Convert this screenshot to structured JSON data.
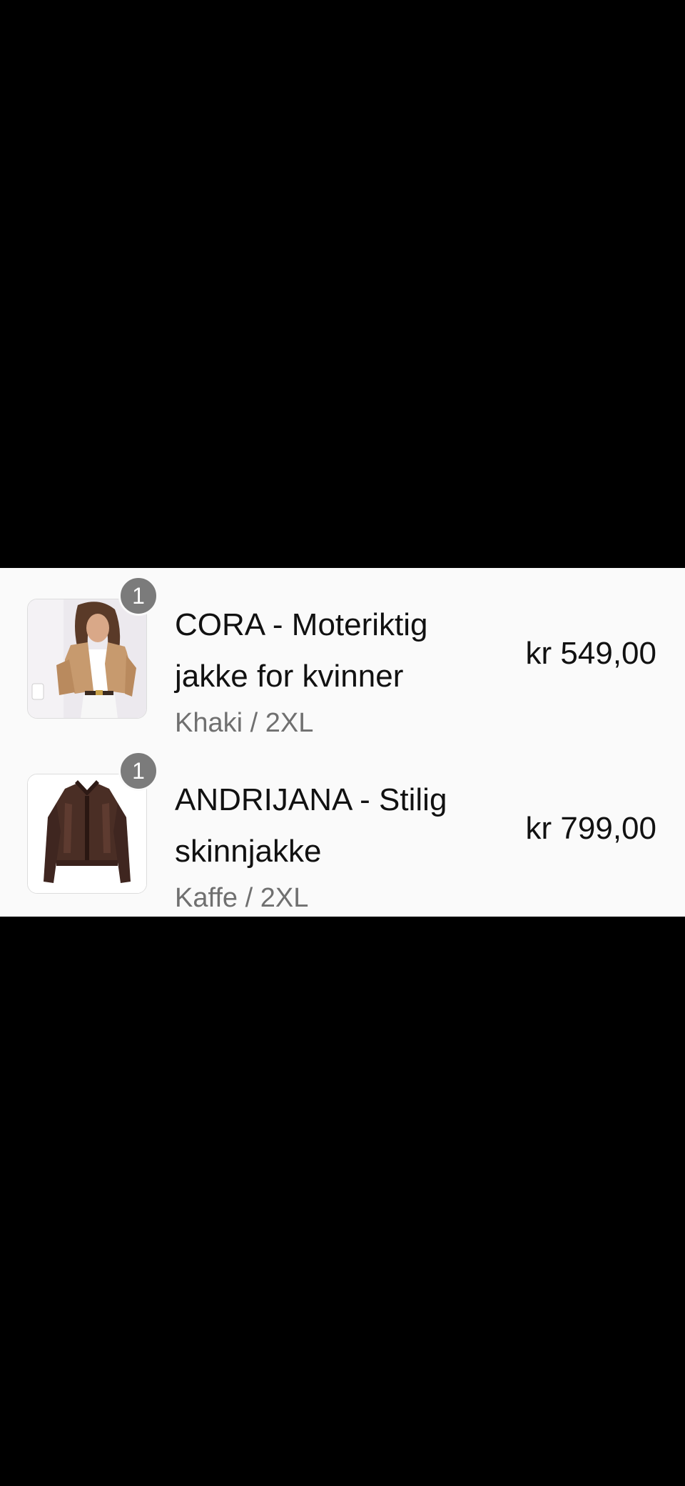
{
  "cart": {
    "items": [
      {
        "quantity": "1",
        "title": "CORA - Moteriktig jakke for kvinner",
        "variant": "Khaki / 2XL",
        "price": "kr 549,00",
        "image_color": "#c79a6e"
      },
      {
        "quantity": "1",
        "title": "ANDRIJANA - Stilig skinnjakke",
        "variant": "Kaffe / 2XL",
        "price": "kr 799,00",
        "image_color": "#4a2e25"
      }
    ]
  }
}
